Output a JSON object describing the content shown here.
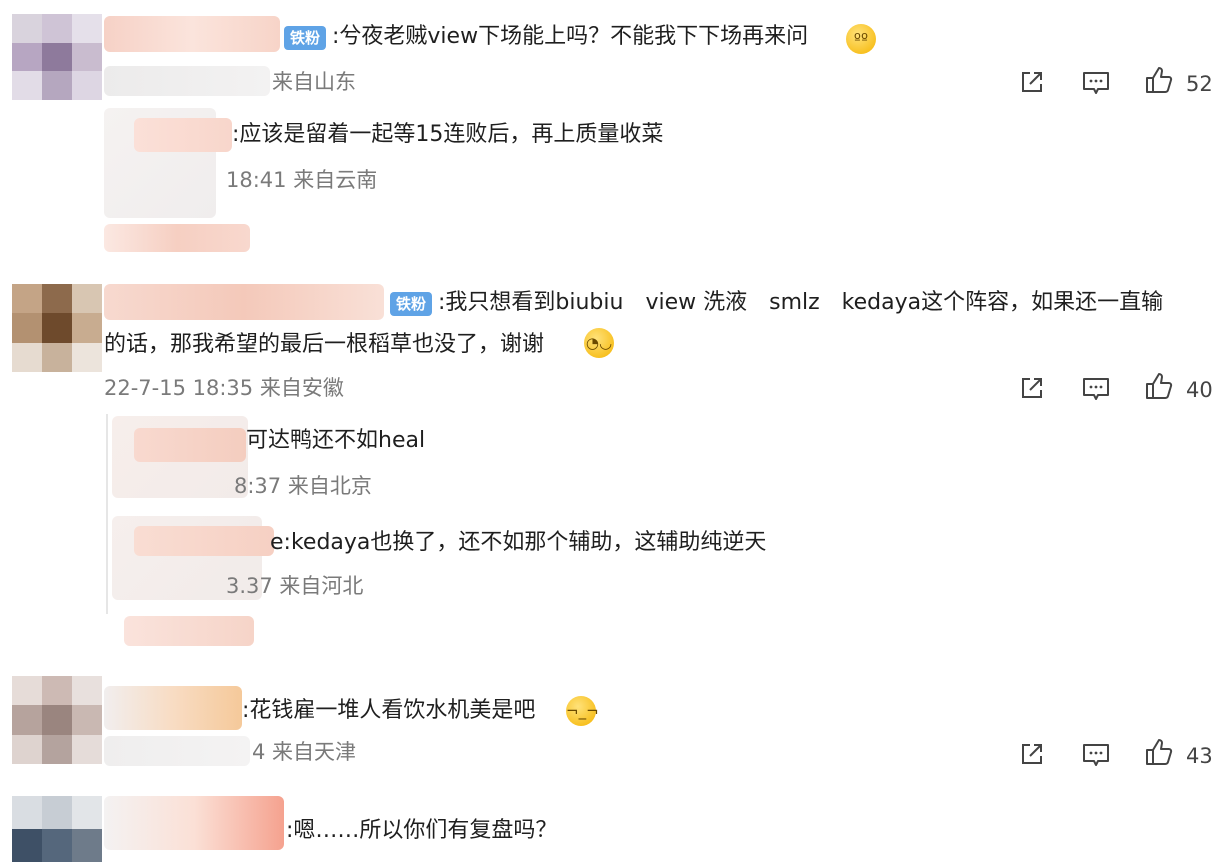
{
  "comments": [
    {
      "badge": "铁粉",
      "text": ":兮夜老贼view下场能上吗？不能我下下场再来问",
      "meta": "来自山东",
      "actions": {
        "like_count": "52"
      },
      "replies": [
        {
          "text": ":应该是留着一起等15连败后，再上质量收菜",
          "meta": "18:41 来自云南"
        }
      ]
    },
    {
      "badge": "铁粉",
      "text_line1": ":我只想看到biubiu　view 洗液　smlz　kedaya这个阵容，如果还一直输",
      "text_line2": "的话，那我希望的最后一根稻草也没了，谢谢",
      "meta": "22-7-15 18:35 来自安徽",
      "actions": {
        "like_count": "40"
      },
      "replies": [
        {
          "text": "可达鸭还不如heal",
          "meta": "8:37 来自北京"
        },
        {
          "text": "e:kedaya也换了，还不如那个辅助，这辅助纯逆天",
          "meta": "3.37 来自河北"
        }
      ]
    },
    {
      "text": ":花钱雇一堆人看饮水机美是吧",
      "meta": "4 来自天津",
      "actions": {
        "like_count": "43"
      }
    },
    {
      "text": ":嗯……所以你们有复盘吗？"
    }
  ],
  "icons": {
    "share": "share-icon",
    "comment": "comment-icon",
    "like": "thumbs-up-icon"
  },
  "colors": {
    "badge": "#5fa3e6",
    "meta": "#7a7a7a"
  }
}
